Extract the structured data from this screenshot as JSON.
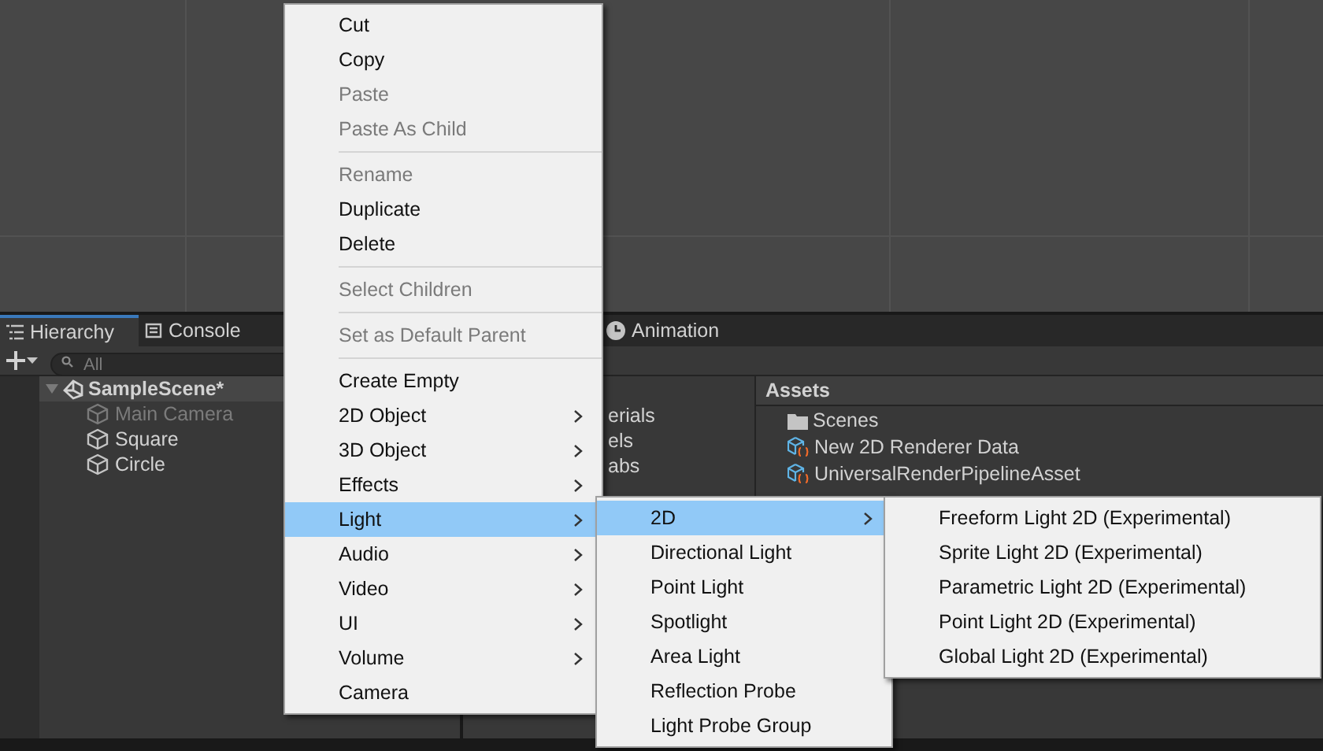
{
  "hierarchy": {
    "tabs": [
      {
        "label": "Hierarchy",
        "selected": true
      },
      {
        "label": "Console",
        "selected": false
      }
    ],
    "search": {
      "placeholder": "All"
    },
    "scene": {
      "label": "SampleScene*",
      "expanded": true
    },
    "objects": [
      {
        "label": "Main Camera",
        "disabled": true
      },
      {
        "label": "Square",
        "disabled": false
      },
      {
        "label": "Circle",
        "disabled": false
      }
    ]
  },
  "project": {
    "tabs": [
      {
        "label": "Animation",
        "selected": false
      }
    ],
    "folders": [
      "erials",
      "els",
      "abs"
    ],
    "assets_title": "Assets",
    "assets": [
      {
        "label": "Scenes",
        "kind": "folder"
      },
      {
        "label": "New 2D Renderer Data",
        "kind": "asset"
      },
      {
        "label": "UniversalRenderPipelineAsset",
        "kind": "asset"
      }
    ]
  },
  "context_menu": [
    {
      "kind": "item",
      "label": "Cut",
      "disabled": false,
      "submenu": false,
      "selected": false
    },
    {
      "kind": "item",
      "label": "Copy",
      "disabled": false,
      "submenu": false,
      "selected": false
    },
    {
      "kind": "item",
      "label": "Paste",
      "disabled": true,
      "submenu": false,
      "selected": false
    },
    {
      "kind": "item",
      "label": "Paste As Child",
      "disabled": true,
      "submenu": false,
      "selected": false
    },
    {
      "kind": "separator"
    },
    {
      "kind": "item",
      "label": "Rename",
      "disabled": true,
      "submenu": false,
      "selected": false
    },
    {
      "kind": "item",
      "label": "Duplicate",
      "disabled": false,
      "submenu": false,
      "selected": false
    },
    {
      "kind": "item",
      "label": "Delete",
      "disabled": false,
      "submenu": false,
      "selected": false
    },
    {
      "kind": "separator"
    },
    {
      "kind": "item",
      "label": "Select Children",
      "disabled": true,
      "submenu": false,
      "selected": false
    },
    {
      "kind": "separator"
    },
    {
      "kind": "item",
      "label": "Set as Default Parent",
      "disabled": true,
      "submenu": false,
      "selected": false
    },
    {
      "kind": "separator"
    },
    {
      "kind": "item",
      "label": "Create Empty",
      "disabled": false,
      "submenu": false,
      "selected": false
    },
    {
      "kind": "item",
      "label": "2D Object",
      "disabled": false,
      "submenu": true,
      "selected": false
    },
    {
      "kind": "item",
      "label": "3D Object",
      "disabled": false,
      "submenu": true,
      "selected": false
    },
    {
      "kind": "item",
      "label": "Effects",
      "disabled": false,
      "submenu": true,
      "selected": false
    },
    {
      "kind": "item",
      "label": "Light",
      "disabled": false,
      "submenu": true,
      "selected": true
    },
    {
      "kind": "item",
      "label": "Audio",
      "disabled": false,
      "submenu": true,
      "selected": false
    },
    {
      "kind": "item",
      "label": "Video",
      "disabled": false,
      "submenu": true,
      "selected": false
    },
    {
      "kind": "item",
      "label": "UI",
      "disabled": false,
      "submenu": true,
      "selected": false
    },
    {
      "kind": "item",
      "label": "Volume",
      "disabled": false,
      "submenu": true,
      "selected": false
    },
    {
      "kind": "item",
      "label": "Camera",
      "disabled": false,
      "submenu": false,
      "selected": false
    }
  ],
  "light_menu": [
    {
      "kind": "item",
      "label": "2D",
      "disabled": false,
      "submenu": true,
      "selected": true
    },
    {
      "kind": "item",
      "label": "Directional Light",
      "disabled": false,
      "submenu": false,
      "selected": false
    },
    {
      "kind": "item",
      "label": "Point Light",
      "disabled": false,
      "submenu": false,
      "selected": false
    },
    {
      "kind": "item",
      "label": "Spotlight",
      "disabled": false,
      "submenu": false,
      "selected": false
    },
    {
      "kind": "item",
      "label": "Area Light",
      "disabled": false,
      "submenu": false,
      "selected": false
    },
    {
      "kind": "item",
      "label": "Reflection Probe",
      "disabled": false,
      "submenu": false,
      "selected": false
    },
    {
      "kind": "item",
      "label": "Light Probe Group",
      "disabled": false,
      "submenu": false,
      "selected": false
    }
  ],
  "light_2d_menu": [
    {
      "kind": "item",
      "label": "Freeform Light 2D (Experimental)",
      "disabled": false,
      "submenu": false,
      "selected": false
    },
    {
      "kind": "item",
      "label": "Sprite Light 2D (Experimental)",
      "disabled": false,
      "submenu": false,
      "selected": false
    },
    {
      "kind": "item",
      "label": "Parametric Light 2D (Experimental)",
      "disabled": false,
      "submenu": false,
      "selected": false
    },
    {
      "kind": "item",
      "label": "Point Light 2D (Experimental)",
      "disabled": false,
      "submenu": false,
      "selected": false
    },
    {
      "kind": "item",
      "label": "Global Light 2D (Experimental)",
      "disabled": false,
      "submenu": false,
      "selected": false
    }
  ]
}
